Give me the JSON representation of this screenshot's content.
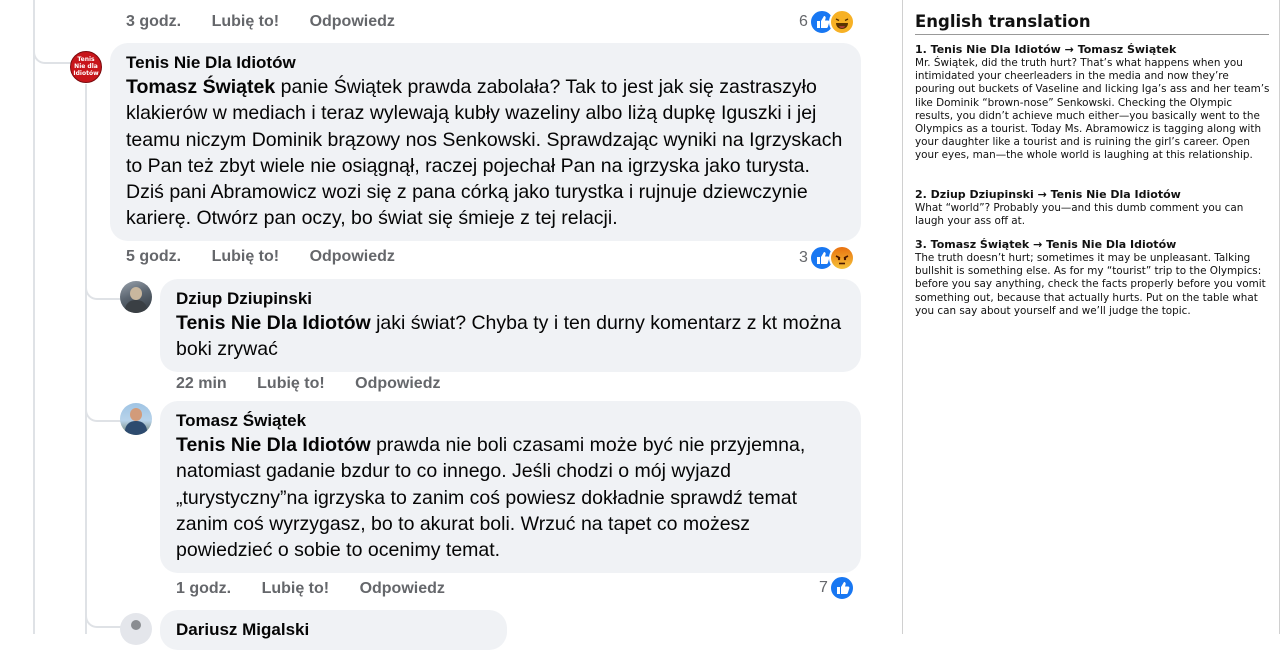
{
  "comments": [
    {
      "author": "Tenis Nie Dla Idiotów",
      "avatar_icon": "tenis-nie-dla-idiotow-logo",
      "avatar_text": "Tenis Nie dla Idiotów",
      "mention": "Tomasz Świątek",
      "text": " panie Świątek prawda zabolała? Tak to jest jak się zastraszyło klakierów w mediach i teraz wylewają kubły wazeliny albo liżą dupkę Iguszki i jej teamu niczym Dominik brązowy nos Senkowski. Sprawdzając wyniki na Igrzyskach to Pan też zbyt wiele nie osiągnął, raczej pojechał Pan na igrzyska jako turysta. Dziś pani Abramowicz wozi się z pana córką jako turystka i rujnuje dziewczynie karierę. Otwórz pan oczy, bo świat się śmieje z tej relacji.",
      "time": "5 godz.",
      "like": "Lubię to!",
      "reply": "Odpowiedz",
      "reaction_count": "3",
      "reactions": [
        "like-icon",
        "angry-icon"
      ]
    },
    {
      "author": "Dziup Dziupinski",
      "mention": "Tenis Nie Dla Idiotów",
      "text": " jaki świat? Chyba ty i ten durny komentarz z kt można boki zrywać",
      "time": "22 min",
      "like": "Lubię to!",
      "reply": "Odpowiedz"
    },
    {
      "author": "Tomasz Świątek",
      "mention": "Tenis Nie Dla Idiotów",
      "text": " prawda nie boli czasami może być nie przyjemna, natomiast gadanie bzdur to co innego. Jeśli chodzi o mój wyjazd „turystyczny”na igrzyska to zanim coś powiesz dokładnie sprawdź temat zanim coś wyrzygasz, bo to akurat boli. Wrzuć na tapet co możesz powiedzieć o sobie to ocenimy temat.",
      "time": "1 godz.",
      "like": "Lubię to!",
      "reply": "Odpowiedz",
      "reaction_count": "7",
      "reactions": [
        "like-icon"
      ]
    },
    {
      "author": "Dariusz Migalski"
    }
  ],
  "top_actions": {
    "time": "3 godz.",
    "like": "Lubię to!",
    "reply": "Odpowiedz",
    "reaction_count": "6",
    "reactions": [
      "like-icon",
      "haha-icon"
    ]
  },
  "translation": {
    "title": "English translation",
    "items": [
      {
        "heading": "1. Tenis Nie Dla Idiotów → Tomasz Świątek",
        "body": "Mr. Świątek, did the truth hurt? That’s what happens when you intimidated your cheerleaders in the media and now they’re pouring out buckets of Vaseline and licking Iga’s ass and her team’s like Dominik “brown-nose” Senkowski. Checking the Olympic results, you didn’t achieve much either—you basically went to the Olympics as a tourist. Today Ms. Abramowicz is tagging along with your daughter like a tourist and is ruining the girl’s career. Open your eyes, man—the whole world is laughing at this relationship."
      },
      {
        "heading": "2. Dziup Dziupinski → Tenis Nie Dla Idiotów",
        "body": "What “world”? Probably you—and this dumb comment you can laugh your ass off at."
      },
      {
        "heading": "3. Tomasz Świątek → Tenis Nie Dla Idiotów",
        "body": "The truth doesn’t hurt; sometimes it may be unpleasant. Talking bullshit is something else. As for my “tourist” trip to the Olympics: before you say anything, check the facts properly before you vomit something out, because that actually hurts. Put on the table what you can say about yourself and we’ll judge the topic."
      }
    ]
  }
}
